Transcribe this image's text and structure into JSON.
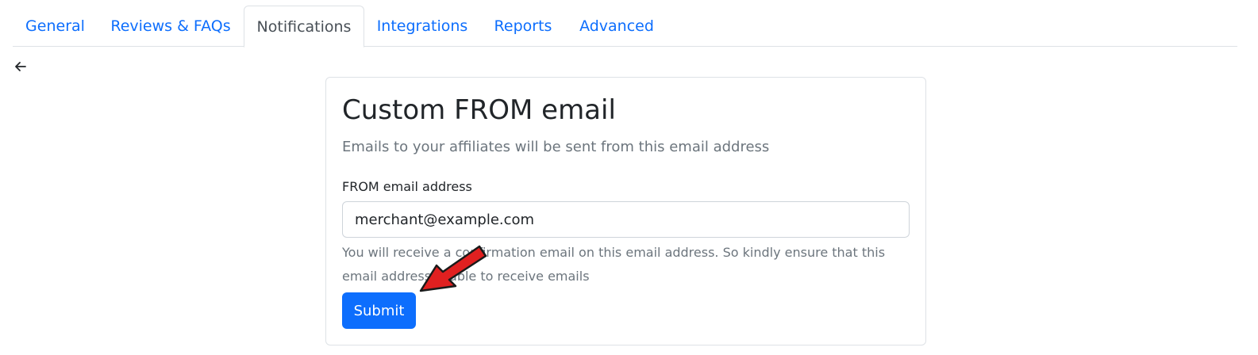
{
  "tabs": [
    {
      "label": "General",
      "active": false
    },
    {
      "label": "Reviews & FAQs",
      "active": false
    },
    {
      "label": "Notifications",
      "active": true
    },
    {
      "label": "Integrations",
      "active": false
    },
    {
      "label": "Reports",
      "active": false
    },
    {
      "label": "Advanced",
      "active": false
    }
  ],
  "back": {
    "icon": "arrow-left-icon"
  },
  "card": {
    "title": "Custom FROM email",
    "subtitle": "Emails to your affiliates will be sent from this email address",
    "field_label": "FROM email address",
    "field_value": "merchant@example.com",
    "help_text": "You will receive a confirmation email on this email address. So kindly ensure that this email address is able to receive emails",
    "submit_label": "Submit"
  },
  "annotation": {
    "icon": "red-arrow-pointer",
    "color": "#e02020"
  },
  "colors": {
    "accent": "#0d6efd",
    "muted": "#6c757d"
  }
}
